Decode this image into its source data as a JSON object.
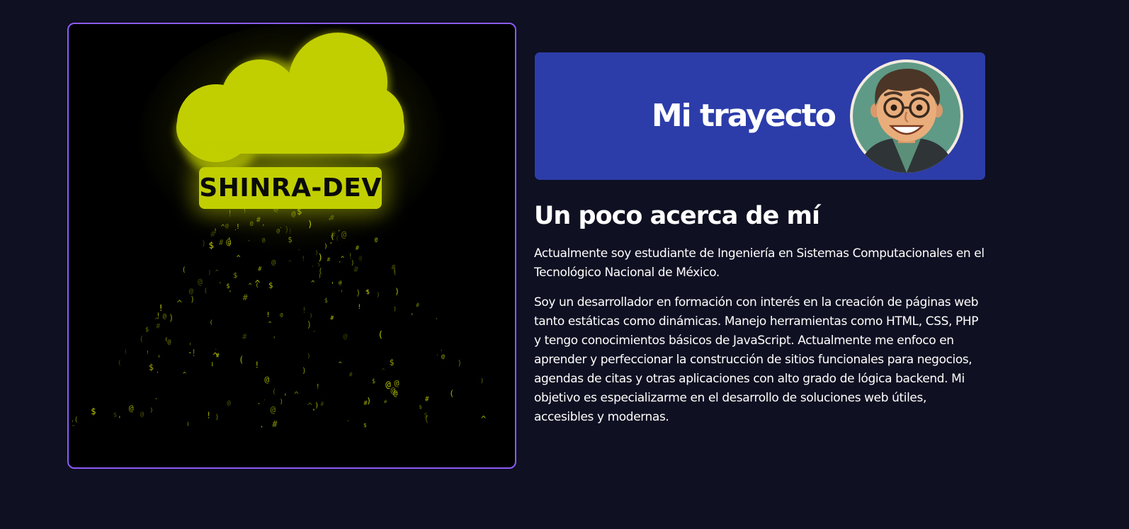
{
  "hero": {
    "brand_label": "SHINRA-DEV",
    "accent_color": "#c1cf00",
    "border_color": "#8b5cf6",
    "icon": "cloud-icon",
    "effect": "code-rain"
  },
  "banner": {
    "title": "Mi trayecto",
    "background_color": "#2c3ca8",
    "avatar_icon": "cartoon-avatar-with-glasses"
  },
  "about": {
    "heading": "Un poco acerca de mí",
    "paragraph_1": "Actualmente soy estudiante de Ingeniería en Sistemas Computacionales en el Tecnológico Nacional de México.",
    "paragraph_2": "Soy un desarrollador en formación con interés en la creación de páginas web tanto estáticas como dinámicas. Manejo herramientas como HTML, CSS, PHP y tengo conocimientos básicos de JavaScript. Actualmente me enfoco en aprender y perfeccionar la construcción de sitios funcionales para negocios, agendas de citas y otras aplicaciones con alto grado de lógica backend. Mi objetivo es especializarme en el desarrollo de soluciones web útiles, accesibles y modernas."
  }
}
